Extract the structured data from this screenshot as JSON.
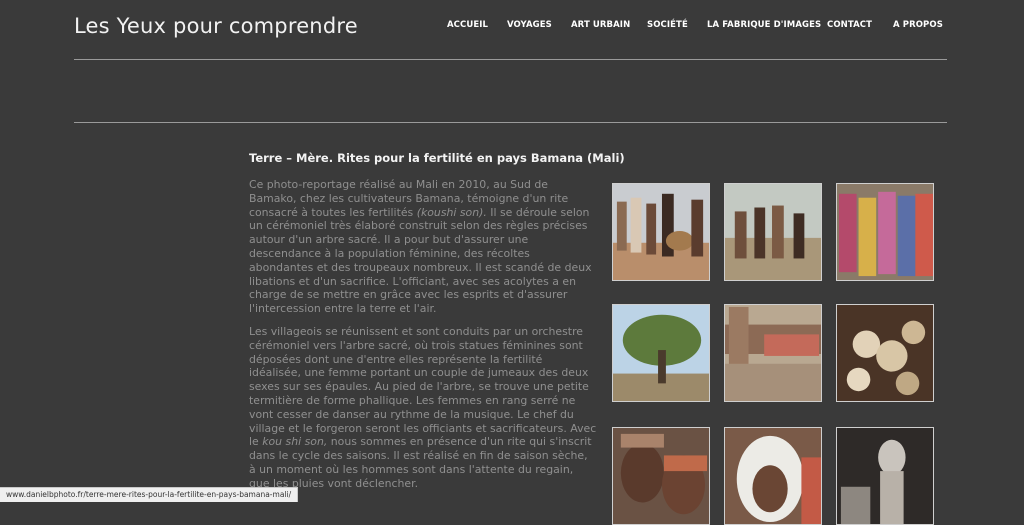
{
  "header": {
    "site_title": "Les Yeux pour comprendre",
    "nav": [
      "ACCUEIL",
      "VOYAGES",
      "ART URBAIN",
      "SOCIÉTÉ",
      "LA FABRIQUE D'IMAGES",
      "CONTACT",
      "A PROPOS"
    ]
  },
  "article": {
    "title": "Terre – Mère. Rites pour la fertilité en pays Bamana (Mali)",
    "p1_a": "Ce photo-reportage réalisé au  Mali en 2010, au Sud de Bamako, chez les cultivateurs Bamana, témoigne d'un rite consacré à toutes les fertilités ",
    "p1_em": "(koushi son).",
    "p1_b": " Il se déroule selon un cérémoniel très élaboré construit selon des règles précises autour d'un arbre sacré. Il a pour but d'assurer une descendance à la population féminine, des récoltes abondantes et des troupeaux nombreux. Il est scandé de deux libations et d'un sacrifice. L'officiant, avec ses acolytes a en charge de se mettre en grâce avec les esprits et d'assurer l'intercession entre la terre et l'air.",
    "p2_a": "Les villageois se réunissent et sont conduits par un orchestre cérémoniel vers l'arbre sacré, où trois statues féminines sont déposées dont une d'entre elles représente la fertilité idéalisée, une femme portant un couple de jumeaux des deux sexes sur ses épaules. Au pied de l'arbre, se trouve une petite termitière de forme phallique. Les femmes en rang serré ne vont cesser de danser au rythme de la musique. Le   chef du village et le forgeron seront les officiants et sacrificateurs. Avec le   ",
    "p2_em": "kou shi son,",
    "p2_b": " nous sommes en présence d'un rite qui s'inscrit dans le cycle des saisons. Il est réalisé en fin de saison sèche, à un moment où les hommes sont dans l'attente du regain, que les pluies vont déclencher."
  },
  "gallery": {
    "photos": [
      "drummers-procession",
      "dancing-men",
      "women-procession",
      "sacred-tree",
      "carved-statue-crowd",
      "ritual-bowls",
      "elderly-woman-portrait",
      "woman-headscarf-portrait",
      "wooden-statue-closeup"
    ]
  },
  "status_bar": {
    "url": "www.danielbphoto.fr/terre-mere-rites-pour-la-fertilite-en-pays-bamana-mali/"
  }
}
